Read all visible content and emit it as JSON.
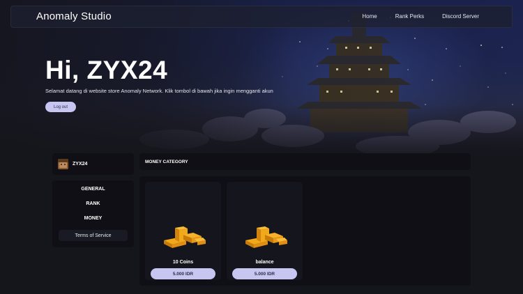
{
  "navbar": {
    "brand": "Anomaly Studio",
    "links": [
      {
        "label": "Home"
      },
      {
        "label": "Rank Perks"
      },
      {
        "label": "Discord Server"
      }
    ]
  },
  "hero": {
    "greeting": "Hi, ZYX24",
    "welcome_text": "Selamat datang di website store Anomaly Network. Klik tombol di bawah jika ingin mengganti akun",
    "logout_label": "Log out"
  },
  "profile": {
    "username": "ZYX24",
    "avatar_icon": "player-head-icon"
  },
  "sidebar": {
    "items": [
      {
        "label": "GENERAL"
      },
      {
        "label": "RANK"
      },
      {
        "label": "MONEY"
      }
    ],
    "tos_label": "Terms of Service"
  },
  "category": {
    "title": "MONEY CATEGORY"
  },
  "products": [
    {
      "name": "10 Coins",
      "price": "5.000 IDR",
      "icon": "gold-coins-icon"
    },
    {
      "name": "balance",
      "price": "5.000 IDR",
      "icon": "gold-coins-icon"
    }
  ],
  "colors": {
    "accent": "#c7c6f0",
    "background": "#15151c",
    "panel": "#0f0f15"
  }
}
